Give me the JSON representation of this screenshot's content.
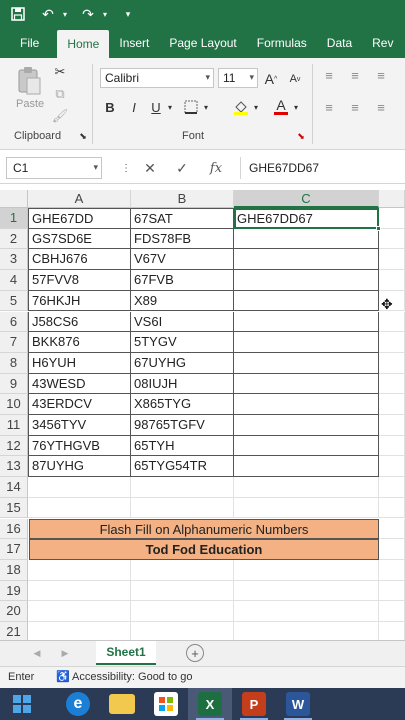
{
  "window": {
    "colors": {
      "accent": "#217346",
      "banner": "#f4b183",
      "taskbar": "#2b3a55"
    }
  },
  "qat": {
    "save_icon": "save-icon",
    "undo_icon": "undo-icon",
    "redo_icon": "redo-icon",
    "customize_icon": "chevron-down-icon"
  },
  "ribbon_tabs": [
    "File",
    "Home",
    "Insert",
    "Page Layout",
    "Formulas",
    "Data",
    "Rev"
  ],
  "active_tab": "Home",
  "ribbon": {
    "clipboard_label": "Clipboard",
    "paste_label": "Paste",
    "font_label": "Font",
    "font_name": "Calibri",
    "font_size": "11",
    "grow_font": "A",
    "shrink_font": "A",
    "bold": "B",
    "italic": "I",
    "underline": "U",
    "font_color": "A"
  },
  "formula_bar": {
    "name_box": "C1",
    "cancel": "✕",
    "enter": "✓",
    "fx": "fx",
    "content": "GHE67DD67"
  },
  "columns": [
    "A",
    "B",
    "C"
  ],
  "rows": [
    {
      "n": "1",
      "a": "GHE67DD",
      "b": "67SAT",
      "c": "GHE67DD67"
    },
    {
      "n": "2",
      "a": "GS7SD6E",
      "b": "FDS78FB",
      "c": ""
    },
    {
      "n": "3",
      "a": "CBHJ676",
      "b": "V67V",
      "c": ""
    },
    {
      "n": "4",
      "a": "57FVV8",
      "b": "67FVB",
      "c": ""
    },
    {
      "n": "5",
      "a": "76HKJH",
      "b": "X89",
      "c": ""
    },
    {
      "n": "6",
      "a": "J58CS6",
      "b": "VS6I",
      "c": ""
    },
    {
      "n": "7",
      "a": "BKK876",
      "b": "5TYGV",
      "c": ""
    },
    {
      "n": "8",
      "a": "H6YUH",
      "b": "67UYHG",
      "c": ""
    },
    {
      "n": "9",
      "a": "43WESD",
      "b": "08IUJH",
      "c": ""
    },
    {
      "n": "10",
      "a": "43ERDCV",
      "b": "X865TYG",
      "c": ""
    },
    {
      "n": "11",
      "a": "3456TYV",
      "b": "98765TGFV",
      "c": ""
    },
    {
      "n": "12",
      "a": "76YTHGVB",
      "b": "65TYH",
      "c": ""
    },
    {
      "n": "13",
      "a": "87UYHG",
      "b": "65TYG54TR",
      "c": ""
    }
  ],
  "empty_rows": [
    "14",
    "15",
    "18",
    "19",
    "20",
    "21"
  ],
  "banner_rows": [
    {
      "n": "16",
      "text": "Flash Fill on Alphanumeric Numbers"
    },
    {
      "n": "17",
      "text": "Tod Fod Education"
    }
  ],
  "sheet_tab": "Sheet1",
  "add_sheet": "+",
  "status": {
    "mode": "Enter",
    "accessibility": "Accessibility: Good to go"
  },
  "taskbar_apps": [
    {
      "name": "start-icon",
      "label": ""
    },
    {
      "name": "edge-icon",
      "label": "e"
    },
    {
      "name": "file-explorer-icon",
      "label": ""
    },
    {
      "name": "store-icon",
      "label": ""
    },
    {
      "name": "excel-icon",
      "label": "X"
    },
    {
      "name": "powerpoint-icon",
      "label": "P"
    },
    {
      "name": "word-icon",
      "label": "W"
    }
  ]
}
